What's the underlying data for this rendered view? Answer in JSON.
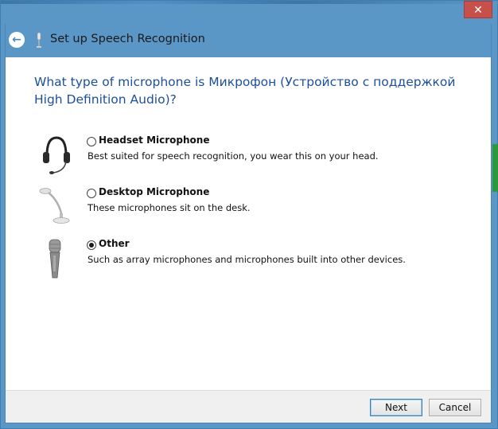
{
  "window": {
    "close_glyph": "✕",
    "title": "Set up Speech Recognition",
    "back_glyph": "←"
  },
  "question": "What type of microphone is Микрофон (Устройство с поддержкой High Definition Audio)?",
  "options": [
    {
      "label": "Headset Microphone",
      "description": "Best suited for speech recognition, you wear this on your head.",
      "icon": "headset-icon",
      "selected": false
    },
    {
      "label": "Desktop Microphone",
      "description": "These microphones sit on the desk.",
      "icon": "desktop-microphone-icon",
      "selected": false
    },
    {
      "label": "Other",
      "description": "Such as array microphones and microphones built into other devices.",
      "icon": "handheld-microphone-icon",
      "selected": true
    }
  ],
  "footer": {
    "next_label": "Next",
    "cancel_label": "Cancel"
  },
  "colors": {
    "titlebar": "#5a96c6",
    "question_text": "#1d4f9a",
    "close_button": "#c7504a"
  }
}
